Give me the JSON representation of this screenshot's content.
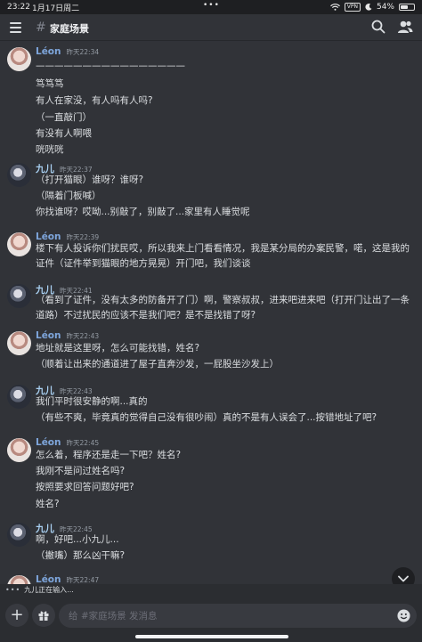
{
  "status_bar": {
    "time": "23:22",
    "date": "1月17日周二",
    "vpn": "VPN",
    "battery_pct": "54%",
    "battery_level": 0.54
  },
  "header": {
    "channel_name": "家庭场景"
  },
  "messages": [
    {
      "author": "Léon",
      "time": "昨天22:34",
      "lines": [
        "————————————————",
        "笃笃笃",
        "有人在家没，有人吗有人吗?",
        "（一直敲门）",
        "有没有人啊喂",
        "咣咣咣"
      ]
    },
    {
      "author": "九儿",
      "time": "昨天22:37",
      "lines": [
        "（打开猫眼）谁呀？谁呀?",
        "（隔着门板喊）",
        "你找谁呀？哎呦...别敲了，别敲了...家里有人睡觉呢"
      ]
    },
    {
      "author": "Léon",
      "time": "昨天22:39",
      "lines": [
        "楼下有人投诉你们扰民哎，所以我来上门看看情况，我是某分局的办案民警，喏，这是我的证件（证件举到猫眼的地方晃晃）开门吧，我们谈谈"
      ]
    },
    {
      "author": "九儿",
      "time": "昨天22:41",
      "lines": [
        "（看到了证件，没有太多的防备开了门）啊，警察叔叔，进来吧进来吧（打开门让出了一条道路）不过扰民的应该不是我们吧？是不是找错了呀?"
      ]
    },
    {
      "author": "Léon",
      "time": "昨天22:43",
      "lines": [
        "地址就是这里呀，怎么可能找错，姓名?",
        "（顺着让出来的通道进了屋子直奔沙发，一屁股坐沙发上）"
      ]
    },
    {
      "author": "九儿",
      "time": "昨天22:43",
      "lines": [
        "我们平时很安静的啊...真的",
        "（有些不爽，毕竟真的觉得自己没有很吵闹）真的不是有人误会了...按错地址了吧?"
      ]
    },
    {
      "author": "Léon",
      "time": "昨天22:45",
      "lines": [
        "怎么着，程序还是走一下吧？姓名?",
        "我刚不是问过姓名吗?",
        "按照要求回答问题好吧?",
        "姓名?"
      ]
    },
    {
      "author": "九儿",
      "time": "昨天22:45",
      "lines": [
        "啊，好吧...小九儿...",
        "（撇嘴）那么凶干嘛?"
      ]
    },
    {
      "author": "Léon",
      "time": "昨天22:47",
      "lines": []
    }
  ],
  "typing_indicator": "九儿正在输入...",
  "composer": {
    "placeholder": "给 #家庭场景 发消息"
  },
  "icons": {
    "menu": "hamburger-icon",
    "channel": "hashtag-icon",
    "search": "search-icon",
    "members": "members-icon",
    "add": "plus-icon",
    "gift": "gift-icon",
    "emoji": "emoji-icon",
    "scroll": "chevron-down-icon"
  }
}
